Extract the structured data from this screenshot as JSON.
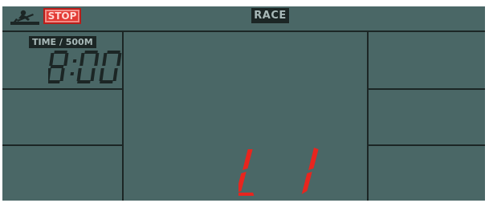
{
  "header": {
    "program_badge": "RACE",
    "stop_badge": "STOP",
    "rower_icon": "rowing-machine-icon"
  },
  "left_panel": {
    "unit_label": "TIME / 500M",
    "value": "8:00"
  },
  "center_panel": {
    "level_indicator": "L 1"
  },
  "colors": {
    "lcd_background": "#4a6766",
    "segment_dark": "#1c2625",
    "segment_red": "#e8251e",
    "stop_badge": "#e33a34"
  }
}
